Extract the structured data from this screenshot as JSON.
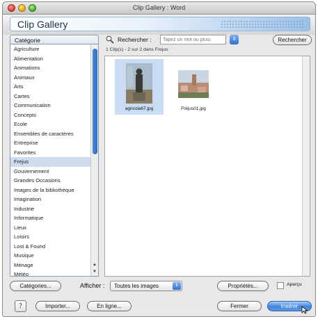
{
  "window": {
    "title": "Clip Gallery : Word",
    "gallery_title": "Clip Gallery"
  },
  "sidebar": {
    "header": "Catégorie",
    "items": [
      {
        "label": "Agriculture"
      },
      {
        "label": "Alimentation"
      },
      {
        "label": "Animations"
      },
      {
        "label": "Animaux"
      },
      {
        "label": "Arts"
      },
      {
        "label": "Cartes"
      },
      {
        "label": "Communication"
      },
      {
        "label": "Concepts"
      },
      {
        "label": "Ecole"
      },
      {
        "label": "Ensembles de caractères"
      },
      {
        "label": "Entreprise"
      },
      {
        "label": "Favorites"
      },
      {
        "label": "Frejus",
        "selected": true
      },
      {
        "label": "Gouvernement"
      },
      {
        "label": "Grandes Occasions"
      },
      {
        "label": "Images de la bibliothèque"
      },
      {
        "label": "Imagination"
      },
      {
        "label": "Industrie"
      },
      {
        "label": "Informatique"
      },
      {
        "label": "Lieux"
      },
      {
        "label": "Loisirs"
      },
      {
        "label": "Lost & Found"
      },
      {
        "label": "Musique"
      },
      {
        "label": "Ménage"
      },
      {
        "label": "Météo"
      }
    ]
  },
  "search": {
    "label": "Rechercher :",
    "placeholder": "Tapez un mot ou plusi",
    "button": "Rechercher"
  },
  "results": {
    "count_text": "1 Clip(s) - 2 sur 2 dans Frejus",
    "clips": [
      {
        "filename": "agricola67.jpg",
        "selected": true
      },
      {
        "filename": "Fréjus01.jpg",
        "selected": false
      }
    ]
  },
  "bottom": {
    "categories_button": "Catégories...",
    "afficher_label": "Afficher :",
    "afficher_value": "Toutes les images",
    "properties_button": "Propriétés...",
    "apercu_label": "Aperçu",
    "help_label": "?",
    "import_button": "Importer...",
    "online_button": "En ligne...",
    "close_button": "Fermer",
    "insert_button": "Insérer"
  },
  "icons": {
    "search": "magnifier-icon",
    "stepper": "up-down-arrows-icon"
  },
  "colors": {
    "selection": "#cfdcee",
    "accent": "#2d6fd0",
    "insert_button": "#3f84dd"
  }
}
